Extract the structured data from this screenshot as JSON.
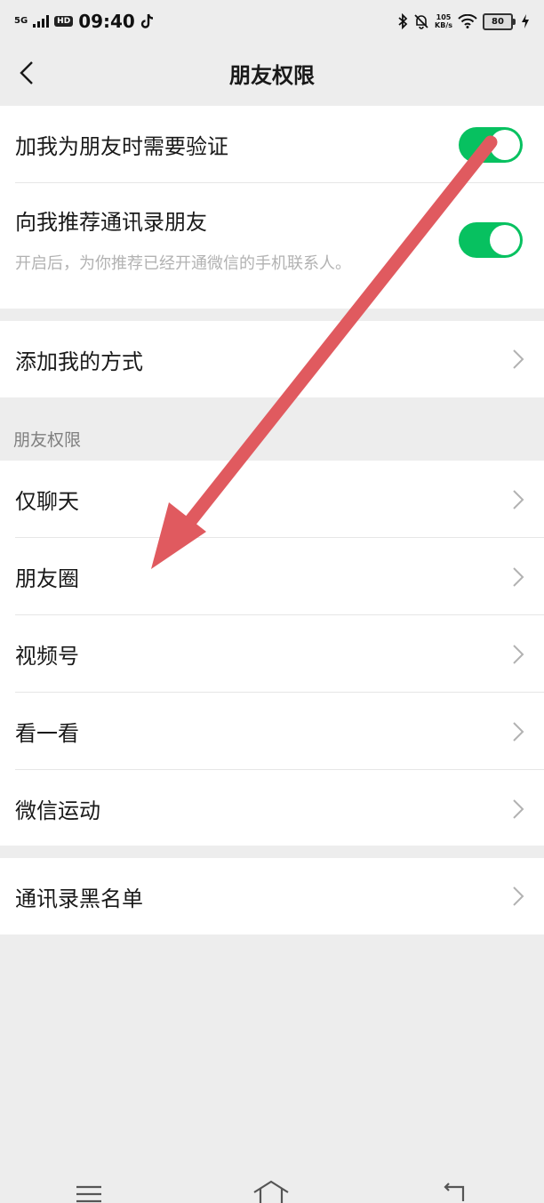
{
  "status_bar": {
    "network": "5G",
    "hd": "HD",
    "time": "09:40",
    "speed_value": "105",
    "speed_unit": "KB/s",
    "battery": "80",
    "icons": [
      "signal-icon",
      "tiktok-icon",
      "bluetooth-icon",
      "mute-bell-icon",
      "wifi-icon",
      "battery-icon",
      "charging-icon"
    ]
  },
  "header": {
    "title": "朋友权限",
    "back_icon": "chevron-left-icon"
  },
  "verify_section": {
    "items": [
      {
        "label": "加我为朋友时需要验证",
        "toggle": true
      },
      {
        "label": "向我推荐通讯录朋友",
        "toggle": true,
        "hint": "开启后，为你推荐已经开通微信的手机联系人。"
      }
    ]
  },
  "add_method": {
    "label": "添加我的方式"
  },
  "permissions_section": {
    "header": "朋友权限",
    "items": [
      {
        "label": "仅聊天"
      },
      {
        "label": "朋友圈"
      },
      {
        "label": "视频号"
      },
      {
        "label": "看一看"
      },
      {
        "label": "微信运动"
      }
    ]
  },
  "blacklist": {
    "label": "通讯录黑名单"
  },
  "colors": {
    "toggle_on": "#07c160",
    "background": "#ededed",
    "annotation_arrow": "#e05a5f"
  },
  "bottom_nav": {
    "icons": [
      "menu-icon",
      "home-icon",
      "back-icon"
    ]
  }
}
